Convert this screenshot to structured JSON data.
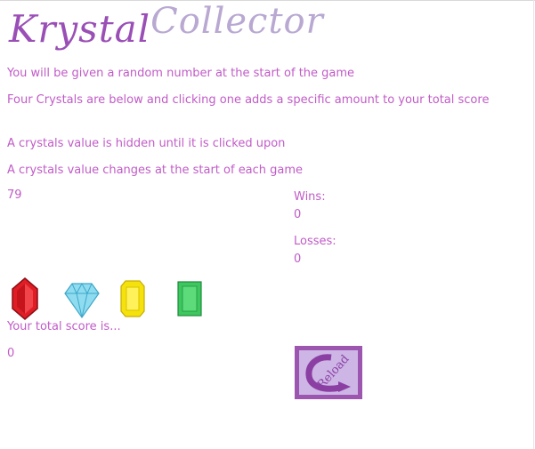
{
  "title": {
    "part1": "Krystal",
    "part2": "Collector"
  },
  "rules": [
    "You will be given a random number at the start of the game",
    "Four Crystals are below and clicking one adds a specific amount to your total score",
    "A crystals value is hidden until it is clicked upon",
    "A crystals value changes at the start of each game"
  ],
  "target_number": "79",
  "stats": {
    "wins_label": "Wins:",
    "wins_value": "0",
    "losses_label": "Losses:",
    "losses_value": "0"
  },
  "crystals": [
    {
      "name": "red-crystal-icon",
      "color": "#e01d25"
    },
    {
      "name": "blue-diamond-icon",
      "color": "#8fdcf0"
    },
    {
      "name": "yellow-crystal-icon",
      "color": "#f5e20c"
    },
    {
      "name": "green-crystal-icon",
      "color": "#3ec65f"
    }
  ],
  "score": {
    "label": "Your total score is...",
    "value": "0"
  },
  "reload": {
    "label": "Reload",
    "icon": "reload-arrow-icon"
  },
  "colors": {
    "text": "#c15bc7",
    "title_dark": "#9a4fb6",
    "title_light": "#b8a8d2",
    "reload_border": "#9c56b0",
    "reload_fill": "#cdb6e6"
  }
}
